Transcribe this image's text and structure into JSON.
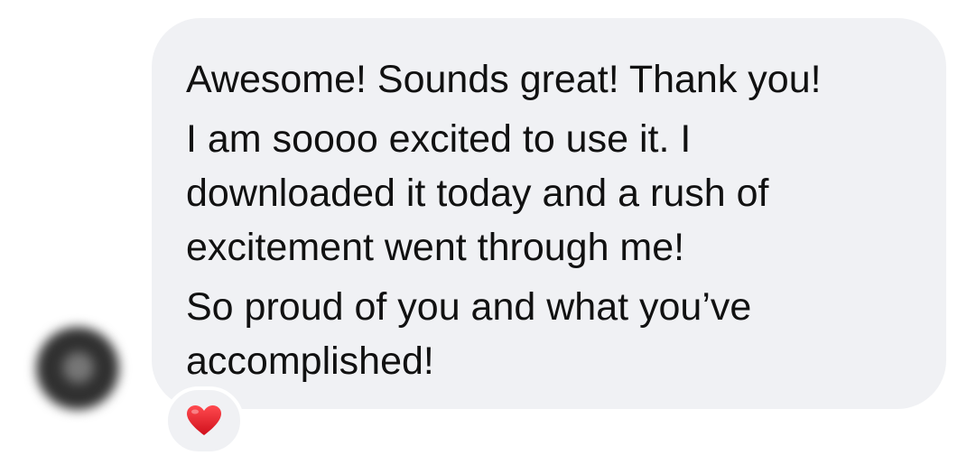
{
  "message": {
    "paragraphs": [
      [
        "Awesome! Sounds great! Thank you!"
      ],
      [
        "I am soooo excited to use it. I",
        "downloaded it today and a rush of",
        "excitement went through me!"
      ],
      [
        "So proud of you and what you’ve",
        "accomplished!"
      ]
    ]
  },
  "reaction": {
    "icon": "red-heart-icon",
    "color": "#e0202b"
  },
  "colors": {
    "bubble": "#f0f1f4",
    "text": "#111111"
  }
}
